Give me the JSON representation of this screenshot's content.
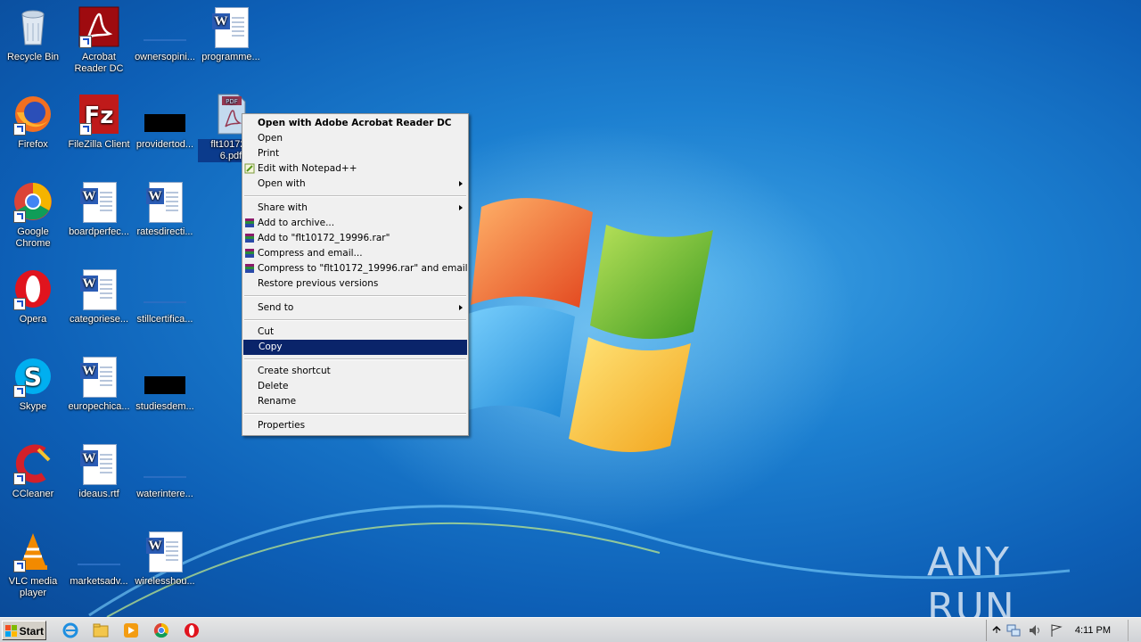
{
  "desktop_icons": [
    {
      "label": "Recycle Bin",
      "icon": "recycle-bin-icon"
    },
    {
      "label": "Acrobat Reader DC",
      "icon": "acrobat-reader-icon"
    },
    {
      "label": "ownersopini...",
      "icon": "blank-file-icon"
    },
    {
      "label": "programme...",
      "icon": "word-document-icon"
    },
    {
      "label": "Firefox",
      "icon": "firefox-icon"
    },
    {
      "label": "FileZilla Client",
      "icon": "filezilla-icon"
    },
    {
      "label": "providertod...",
      "icon": "blank-file-icon"
    },
    {
      "label": "flt10172_ 6.pdf",
      "icon": "pdf-file-icon",
      "selected": true
    },
    {
      "label": "Google Chrome",
      "icon": "chrome-icon"
    },
    {
      "label": "boardperfec...",
      "icon": "word-document-icon"
    },
    {
      "label": "ratesdirecti...",
      "icon": "word-document-icon"
    },
    {
      "label": "Opera",
      "icon": "opera-icon"
    },
    {
      "label": "categoriese...",
      "icon": "word-document-icon"
    },
    {
      "label": "stillcertifica...",
      "icon": "blank-file-icon"
    },
    {
      "label": "Skype",
      "icon": "skype-icon"
    },
    {
      "label": "europechica...",
      "icon": "word-document-icon"
    },
    {
      "label": "studiesdem...",
      "icon": "blank-file-icon"
    },
    {
      "label": "CCleaner",
      "icon": "ccleaner-icon"
    },
    {
      "label": "ideaus.rtf",
      "icon": "word-document-icon"
    },
    {
      "label": "waterintere...",
      "icon": "blank-file-icon"
    },
    {
      "label": "VLC media player",
      "icon": "vlc-icon"
    },
    {
      "label": "marketsadv...",
      "icon": "blank-file-icon"
    },
    {
      "label": "wirelesshou...",
      "icon": "word-document-icon"
    }
  ],
  "context_menu": {
    "items": [
      {
        "label": "Open with Adobe Acrobat Reader DC",
        "bold": true
      },
      {
        "label": "Open"
      },
      {
        "label": "Print"
      },
      {
        "label": "Edit with Notepad++",
        "icon": "notepad-plus-plus-icon"
      },
      {
        "label": "Open with",
        "submenu": true
      },
      {
        "separator": true
      },
      {
        "label": "Share with",
        "submenu": true
      },
      {
        "label": "Add to archive...",
        "icon": "winrar-icon"
      },
      {
        "label": "Add to \"flt10172_19996.rar\"",
        "icon": "winrar-icon"
      },
      {
        "label": "Compress and email...",
        "icon": "winrar-icon"
      },
      {
        "label": "Compress to \"flt10172_19996.rar\" and email",
        "icon": "winrar-icon"
      },
      {
        "label": "Restore previous versions"
      },
      {
        "separator": true
      },
      {
        "label": "Send to",
        "submenu": true
      },
      {
        "separator": true
      },
      {
        "label": "Cut"
      },
      {
        "label": "Copy",
        "highlighted": true
      },
      {
        "separator": true
      },
      {
        "label": "Create shortcut"
      },
      {
        "label": "Delete"
      },
      {
        "label": "Rename"
      },
      {
        "separator": true
      },
      {
        "label": "Properties"
      }
    ]
  },
  "taskbar": {
    "start_label": "Start",
    "pinned": [
      "internet-explorer-icon",
      "file-explorer-icon",
      "media-player-icon",
      "chrome-icon",
      "opera-icon"
    ],
    "tray_icons": [
      "show-hidden-icons-icon",
      "network-icon",
      "volume-icon",
      "action-center-flag-icon"
    ],
    "clock": "4:11 PM"
  },
  "watermark": "ANY RUN",
  "colors": {
    "menu_highlight": "#0a246a",
    "selection": "#0b3b8c"
  }
}
